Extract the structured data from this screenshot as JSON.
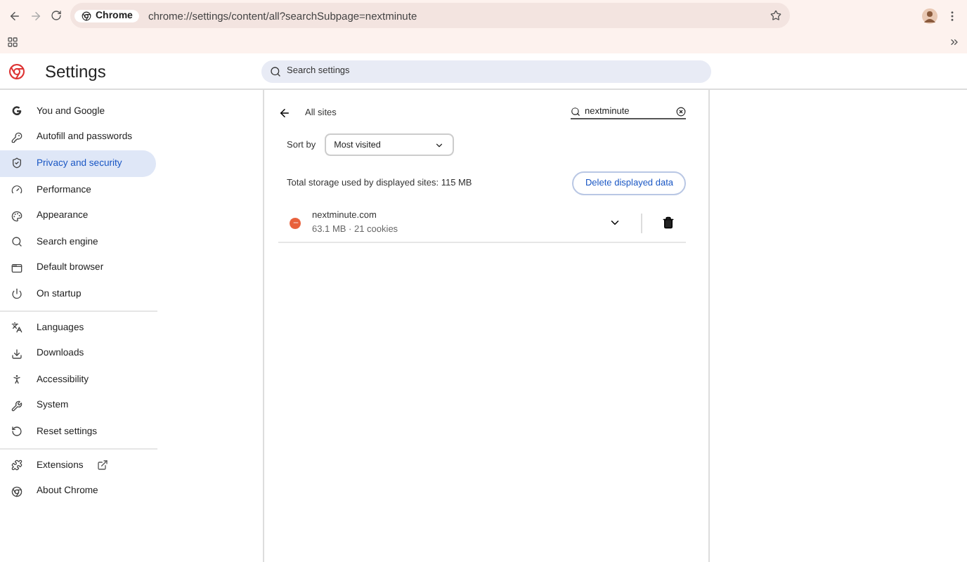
{
  "browser": {
    "chip": "Chrome",
    "url": "chrome://settings/content/all?searchSubpage=nextminute"
  },
  "header": {
    "title": "Settings",
    "search_placeholder": "Search settings"
  },
  "sidebar": {
    "groups": [
      [
        {
          "label": "You and Google",
          "selected": false
        },
        {
          "label": "Autofill and passwords",
          "selected": false
        },
        {
          "label": "Privacy and security",
          "selected": true
        },
        {
          "label": "Performance",
          "selected": false
        },
        {
          "label": "Appearance",
          "selected": false
        },
        {
          "label": "Search engine",
          "selected": false
        },
        {
          "label": "Default browser",
          "selected": false
        },
        {
          "label": "On startup",
          "selected": false
        }
      ],
      [
        {
          "label": "Languages",
          "selected": false
        },
        {
          "label": "Downloads",
          "selected": false
        },
        {
          "label": "Accessibility",
          "selected": false
        },
        {
          "label": "System",
          "selected": false
        },
        {
          "label": "Reset settings",
          "selected": false
        }
      ],
      [
        {
          "label": "Extensions",
          "selected": false,
          "external": true
        },
        {
          "label": "About Chrome",
          "selected": false
        }
      ]
    ]
  },
  "page": {
    "title": "All sites",
    "filter": "nextminute",
    "sort_label": "Sort by",
    "sort_value": "Most visited",
    "storage": "Total storage used by displayed sites: 115 MB",
    "delete_button": "Delete displayed data",
    "sites": [
      {
        "name": "nextminute.com",
        "detail": "63.1 MB · 21 cookies",
        "color": "#e8613c"
      }
    ]
  }
}
